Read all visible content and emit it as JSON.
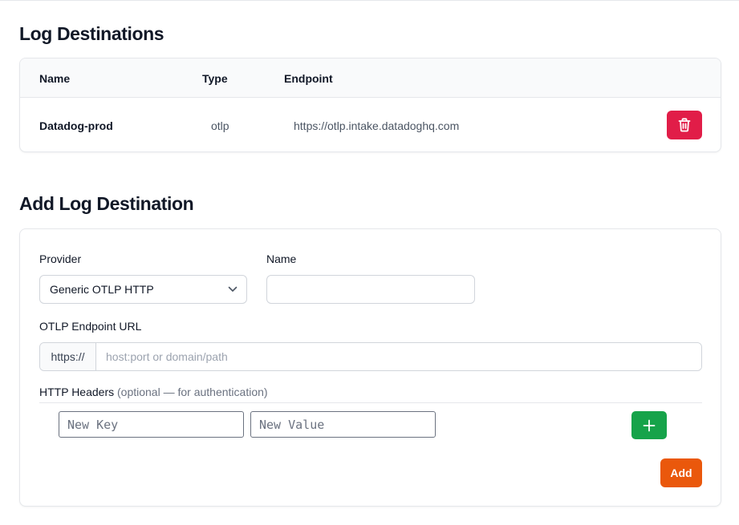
{
  "destinations": {
    "title": "Log Destinations",
    "columns": {
      "name": "Name",
      "type": "Type",
      "endpoint": "Endpoint"
    },
    "rows": [
      {
        "name": "Datadog-prod",
        "type": "otlp",
        "endpoint": "https://otlp.intake.datadoghq.com",
        "action_icon": "trash-icon"
      }
    ]
  },
  "form": {
    "title": "Add Log Destination",
    "provider_label": "Provider",
    "provider_value": "Generic OTLP HTTP",
    "name_label": "Name",
    "name_value": "",
    "endpoint_label": "OTLP Endpoint URL",
    "endpoint_prefix": "https://",
    "endpoint_placeholder": "host:port or domain/path",
    "endpoint_value": "",
    "headers_label": "HTTP Headers",
    "headers_hint": "(optional — for authentication)",
    "header_key_placeholder": "New Key",
    "header_value_placeholder": "New Value",
    "add_header_icon": "plus-icon",
    "submit_label": "Add"
  },
  "colors": {
    "delete": "#e11d48",
    "add_header": "#16a34a",
    "submit": "#ea580c"
  }
}
